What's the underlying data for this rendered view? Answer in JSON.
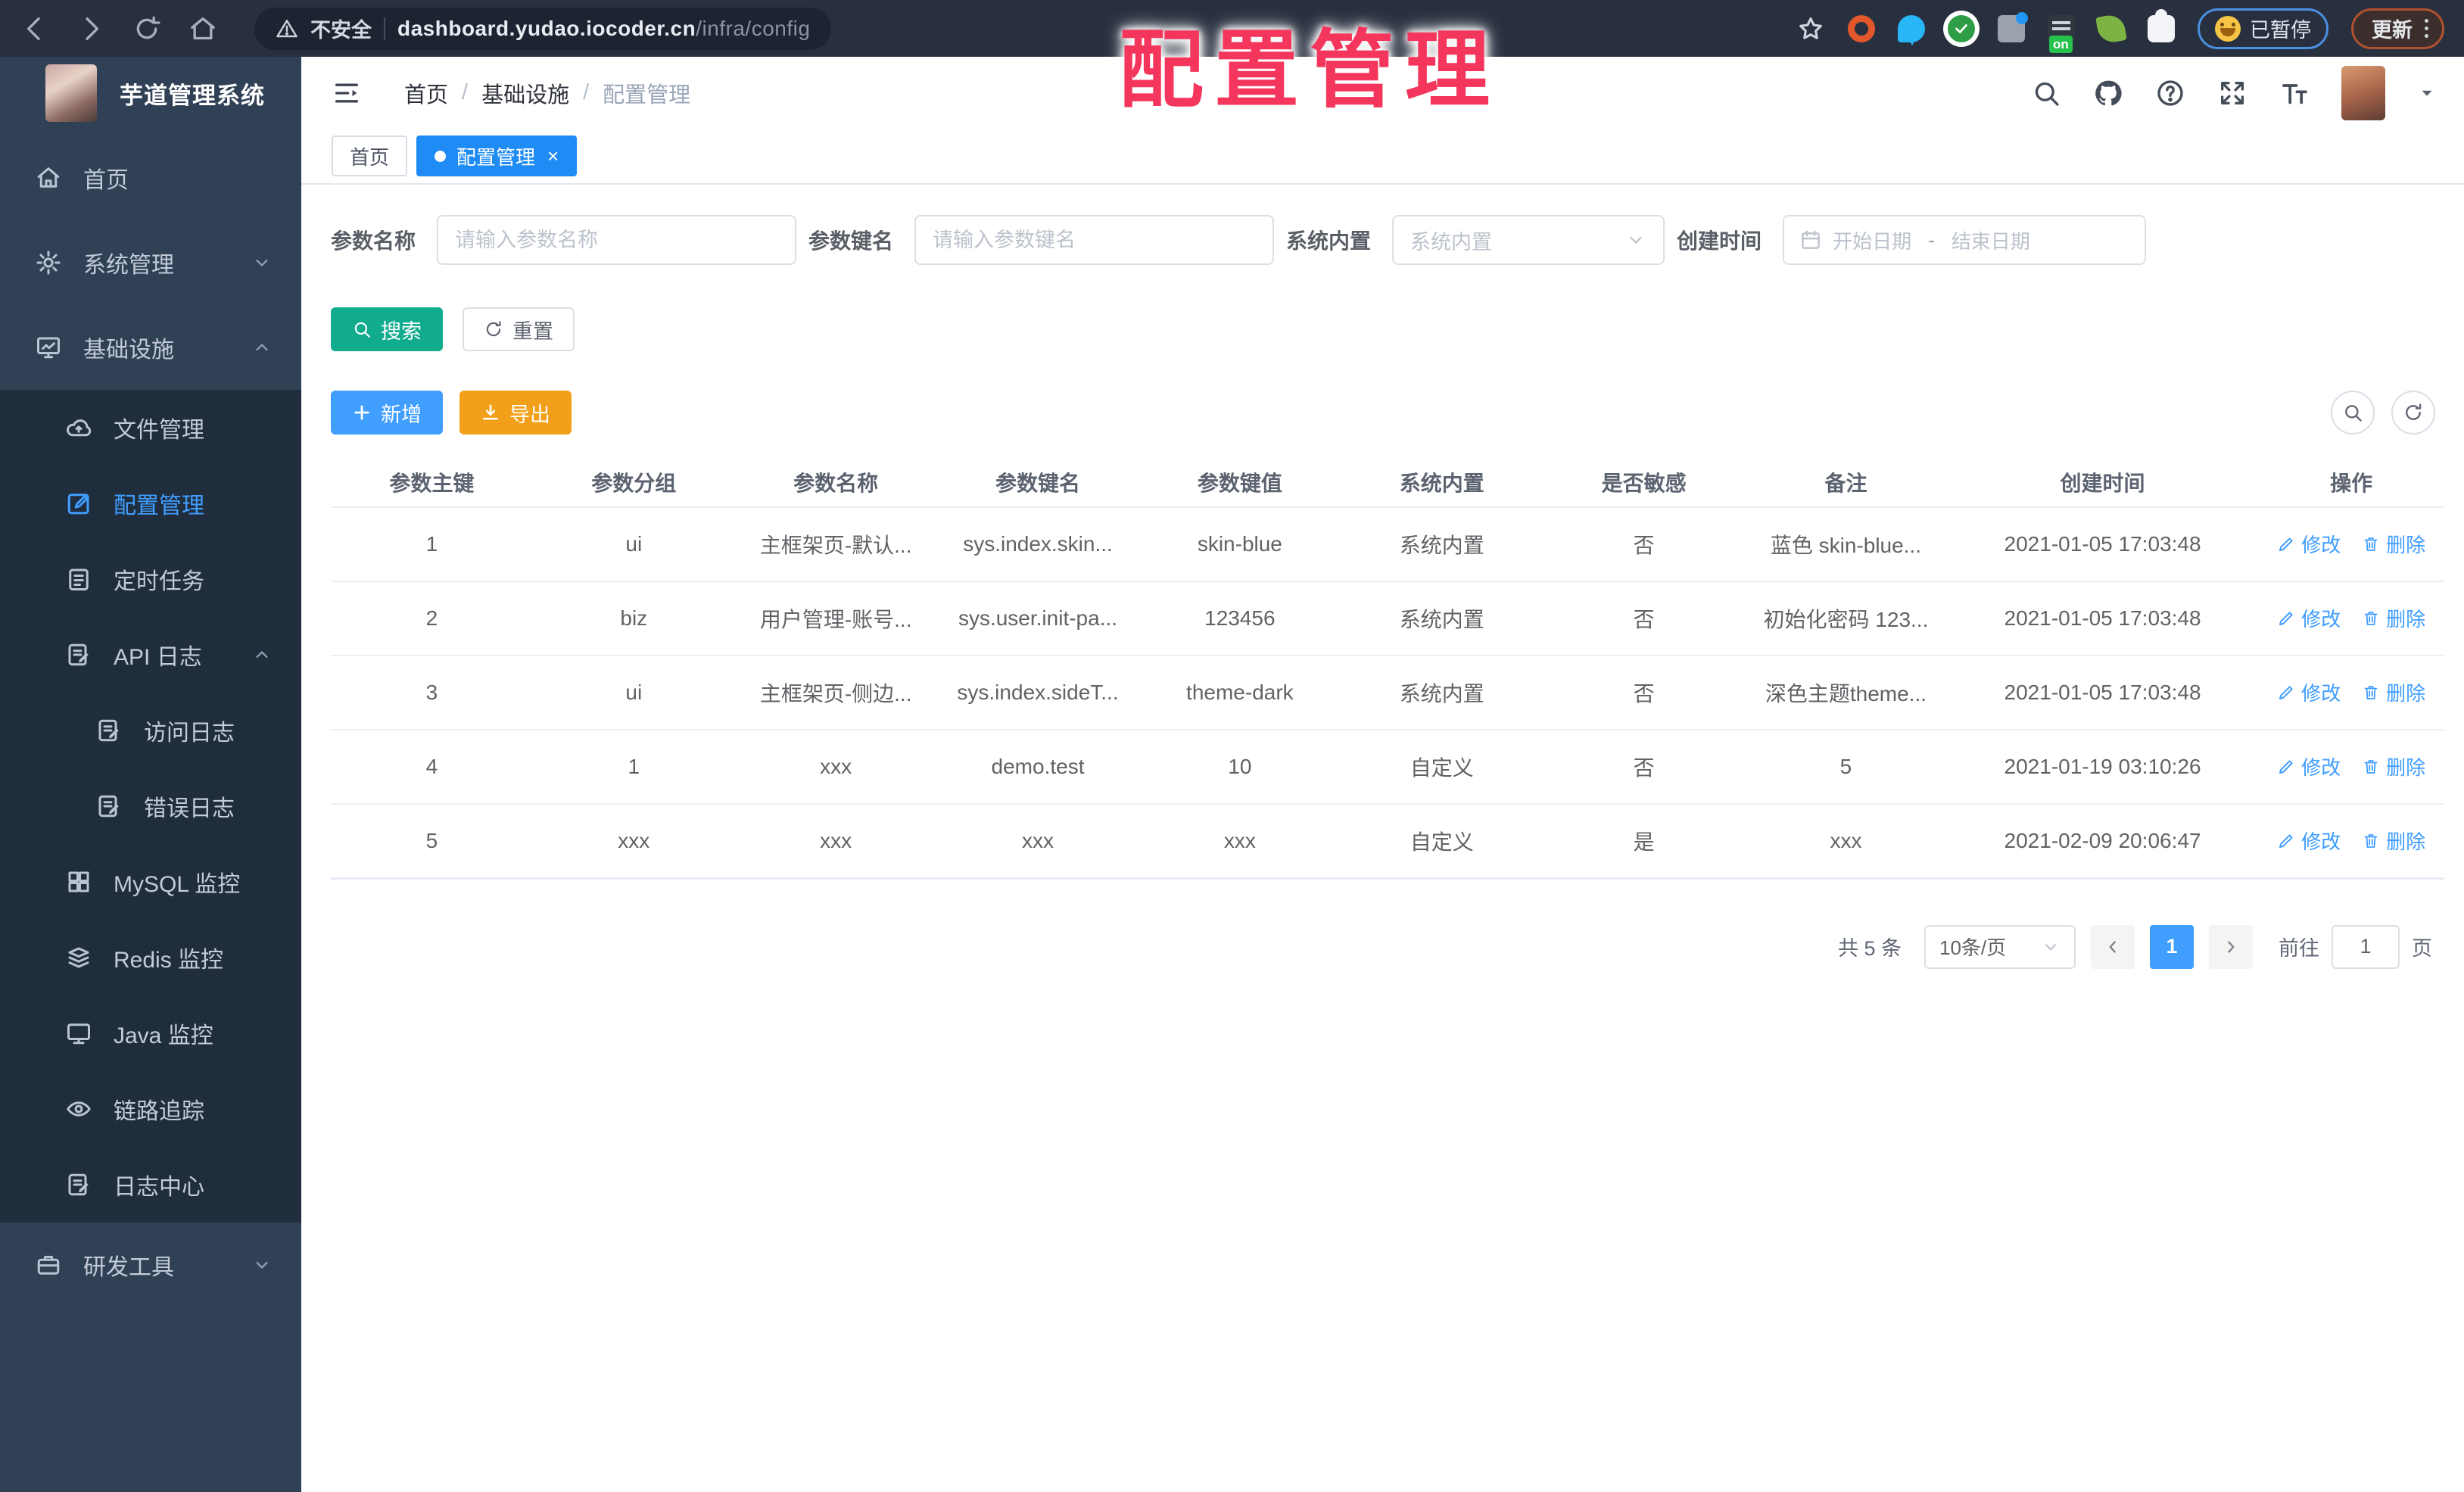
{
  "browser": {
    "security_label": "不安全",
    "url_host": "dashboard.yudao.iocoder.cn",
    "url_path": "/infra/config",
    "paused_label": "已暂停",
    "update_label": "更新"
  },
  "annotation": {
    "text": "配置管理",
    "color": "#f5365c"
  },
  "sidebar": {
    "title": "芋道管理系统",
    "items": [
      {
        "label": "首页",
        "icon": "home",
        "level": 1,
        "block": "top"
      },
      {
        "label": "系统管理",
        "icon": "gear",
        "level": 1,
        "block": "top",
        "chevron": "down"
      },
      {
        "label": "基础设施",
        "icon": "infra",
        "level": 1,
        "block": "top",
        "chevron": "up"
      },
      {
        "label": "文件管理",
        "icon": "cloud",
        "level": 2,
        "block": "sub"
      },
      {
        "label": "配置管理",
        "icon": "edit",
        "level": 2,
        "block": "sub",
        "active": true
      },
      {
        "label": "定时任务",
        "icon": "task",
        "level": 2,
        "block": "sub"
      },
      {
        "label": "API 日志",
        "icon": "logdoc",
        "level": 2,
        "block": "sub",
        "chevron": "up"
      },
      {
        "label": "访问日志",
        "icon": "logdoc",
        "level": 3,
        "block": "sub"
      },
      {
        "label": "错误日志",
        "icon": "logdoc",
        "level": 3,
        "block": "sub"
      },
      {
        "label": "MySQL 监控",
        "icon": "grid",
        "level": 2,
        "block": "sub"
      },
      {
        "label": "Redis 监控",
        "icon": "stack",
        "level": 2,
        "block": "sub"
      },
      {
        "label": "Java 监控",
        "icon": "screen",
        "level": 2,
        "block": "sub"
      },
      {
        "label": "链路追踪",
        "icon": "eye",
        "level": 2,
        "block": "sub"
      },
      {
        "label": "日志中心",
        "icon": "logdoc",
        "level": 2,
        "block": "sub"
      },
      {
        "label": "研发工具",
        "icon": "briefcase",
        "level": 1,
        "block": "tail",
        "chevron": "down"
      }
    ]
  },
  "topbar": {
    "breadcrumb": [
      "首页",
      "基础设施",
      "配置管理"
    ]
  },
  "tabs": [
    {
      "label": "首页",
      "active": false,
      "closable": false
    },
    {
      "label": "配置管理",
      "active": true,
      "closable": true
    }
  ],
  "filters": {
    "name_label": "参数名称",
    "name_placeholder": "请输入参数名称",
    "key_label": "参数键名",
    "key_placeholder": "请输入参数键名",
    "builtin_label": "系统内置",
    "builtin_placeholder": "系统内置",
    "time_label": "创建时间",
    "start_placeholder": "开始日期",
    "range_separator": "-",
    "end_placeholder": "结束日期"
  },
  "buttons": {
    "search": "搜索",
    "reset": "重置",
    "add": "新增",
    "export": "导出"
  },
  "table": {
    "headers": [
      "参数主键",
      "参数分组",
      "参数名称",
      "参数键名",
      "参数键值",
      "系统内置",
      "是否敏感",
      "备注",
      "创建时间",
      "操作"
    ],
    "action_labels": {
      "edit": "修改",
      "delete": "删除"
    },
    "rows": [
      {
        "cells": [
          "1",
          "ui",
          "主框架页-默认...",
          "sys.index.skin...",
          "skin-blue",
          "系统内置",
          "否",
          "蓝色 skin-blue...",
          "2021-01-05 17:03:48"
        ]
      },
      {
        "cells": [
          "2",
          "biz",
          "用户管理-账号...",
          "sys.user.init-pa...",
          "123456",
          "系统内置",
          "否",
          "初始化密码 123...",
          "2021-01-05 17:03:48"
        ]
      },
      {
        "cells": [
          "3",
          "ui",
          "主框架页-侧边...",
          "sys.index.sideT...",
          "theme-dark",
          "系统内置",
          "否",
          "深色主题theme...",
          "2021-01-05 17:03:48"
        ]
      },
      {
        "cells": [
          "4",
          "1",
          "xxx",
          "demo.test",
          "10",
          "自定义",
          "否",
          "5",
          "2021-01-19 03:10:26"
        ]
      },
      {
        "cells": [
          "5",
          "xxx",
          "xxx",
          "xxx",
          "xxx",
          "自定义",
          "是",
          "xxx",
          "2021-02-09 20:06:47"
        ]
      }
    ]
  },
  "pagination": {
    "total": "共 5 条",
    "page_size": "10条/页",
    "current_page": "1",
    "goto_label": "前往",
    "goto_value": "1",
    "page_unit": "页"
  },
  "colors": {
    "primary": "#409eff",
    "success": "#11ab8e",
    "warning": "#f2a019",
    "sidebar_bg": "#304156",
    "submenu_bg": "#1f2d3d"
  }
}
